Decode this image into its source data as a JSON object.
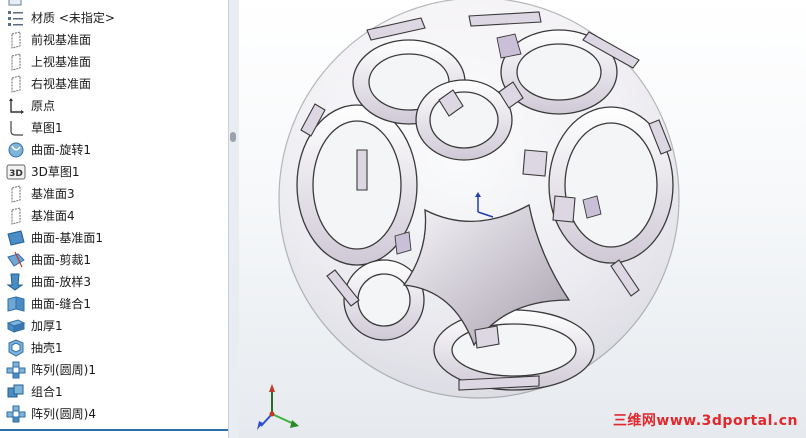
{
  "feature_tree": {
    "items": [
      {
        "label": "",
        "icon": "part-history-icon"
      },
      {
        "label": "材质 <未指定>",
        "icon": "material-icon"
      },
      {
        "label": "前视基准面",
        "icon": "plane-icon"
      },
      {
        "label": "上视基准面",
        "icon": "plane-icon"
      },
      {
        "label": "右视基准面",
        "icon": "plane-icon"
      },
      {
        "label": "原点",
        "icon": "origin-icon"
      },
      {
        "label": "草图1",
        "icon": "sketch-icon"
      },
      {
        "label": "曲面-旋转1",
        "icon": "revolve-surface-icon"
      },
      {
        "label": "3D草图1",
        "icon": "3d-sketch-icon"
      },
      {
        "label": "基准面3",
        "icon": "plane-icon"
      },
      {
        "label": "基准面4",
        "icon": "plane-icon"
      },
      {
        "label": "曲面-基准面1",
        "icon": "planar-surface-icon"
      },
      {
        "label": "曲面-剪裁1",
        "icon": "trim-surface-icon"
      },
      {
        "label": "曲面-放样3",
        "icon": "loft-surface-icon"
      },
      {
        "label": "曲面-缝合1",
        "icon": "knit-surface-icon"
      },
      {
        "label": "加厚1",
        "icon": "thicken-icon"
      },
      {
        "label": "抽壳1",
        "icon": "shell-icon"
      },
      {
        "label": "阵列(圆周)1",
        "icon": "circular-pattern-icon"
      },
      {
        "label": "组合1",
        "icon": "combine-icon"
      },
      {
        "label": "阵列(圆周)4",
        "icon": "circular-pattern-icon"
      }
    ]
  },
  "viewport": {
    "model": "hollow-sphere-part",
    "watermark": "三维网www.3dportal.cn"
  },
  "colors": {
    "accent": "#2f6fa8",
    "model_face": "#d9d4de",
    "model_edge": "#3a3a3a",
    "watermark": "#e0282d"
  }
}
